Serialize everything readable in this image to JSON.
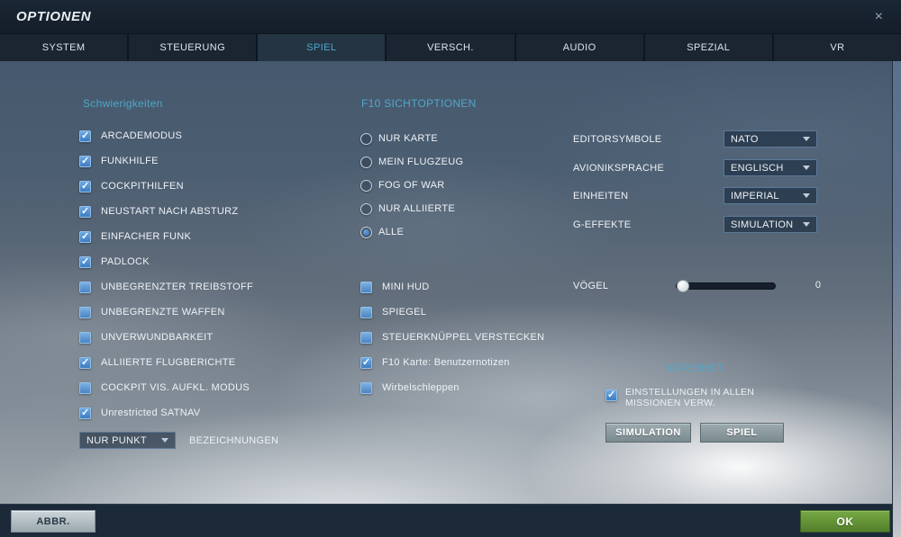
{
  "window": {
    "title": "OPTIONEN",
    "close_label": "×"
  },
  "tabs": {
    "items": [
      {
        "label": "SYSTEM",
        "active": false
      },
      {
        "label": "STEUERUNG",
        "active": false
      },
      {
        "label": "SPIEL",
        "active": true
      },
      {
        "label": "VERSCH.",
        "active": false
      },
      {
        "label": "AUDIO",
        "active": false
      },
      {
        "label": "SPEZIAL",
        "active": false
      },
      {
        "label": "VR",
        "active": false
      }
    ]
  },
  "difficulty": {
    "header": "Schwierigkeiten",
    "options": [
      {
        "label": "ARCADEMODUS",
        "checked": true
      },
      {
        "label": "FUNKHILFE",
        "checked": true
      },
      {
        "label": "COCKPITHILFEN",
        "checked": true
      },
      {
        "label": "NEUSTART NACH ABSTURZ",
        "checked": true
      },
      {
        "label": "EINFACHER FUNK",
        "checked": true
      },
      {
        "label": "PADLOCK",
        "checked": true
      },
      {
        "label": "UNBEGRENZTER TREIBSTOFF",
        "checked": false
      },
      {
        "label": "UNBEGRENZTE WAFFEN",
        "checked": false
      },
      {
        "label": "UNVERWUNDBARKEIT",
        "checked": false
      },
      {
        "label": "ALLIIERTE FLUGBERICHTE",
        "checked": true
      },
      {
        "label": "COCKPIT VIS. AUFKL. MODUS",
        "checked": false
      },
      {
        "label": "Unrestricted SATNAV",
        "checked": true
      }
    ],
    "labels_dropdown": {
      "value": "NUR PUNKT",
      "label": "BEZEICHNUNGEN"
    }
  },
  "f10_view": {
    "header": "F10 SICHTOPTIONEN",
    "options": [
      {
        "label": "NUR KARTE",
        "selected": false
      },
      {
        "label": "MEIN FLUGZEUG",
        "selected": false
      },
      {
        "label": "FOG OF WAR",
        "selected": false
      },
      {
        "label": "NUR ALLIIERTE",
        "selected": false
      },
      {
        "label": "ALLE",
        "selected": true
      }
    ]
  },
  "game_checkboxes": [
    {
      "label": "MINI HUD",
      "checked": false
    },
    {
      "label": "SPIEGEL",
      "checked": false
    },
    {
      "label": "STEUERKNÜPPEL VERSTECKEN",
      "checked": false
    },
    {
      "label": "F10 Karte: Benutzernotizen",
      "checked": true
    },
    {
      "label": "Wirbelschleppen",
      "checked": false
    }
  ],
  "settings": {
    "dropdowns": [
      {
        "label": "EDITORSYMBOLE",
        "value": "NATO"
      },
      {
        "label": "AVIONIKSPRACHE",
        "value": "ENGLISCH"
      },
      {
        "label": "EINHEITEN",
        "value": "IMPERIAL"
      },
      {
        "label": "G-EFFEKTE",
        "value": "SIMULATION"
      }
    ],
    "slider": {
      "label": "VÖGEL",
      "value": "0",
      "percent": 0
    }
  },
  "presets": {
    "header": "VOREINST.",
    "checkbox": {
      "label_line1": "EINSTELLUNGEN IN ALLEN",
      "label_line2": "MISSIONEN VERW.",
      "checked": true
    },
    "buttons": [
      {
        "label": "SIMULATION"
      },
      {
        "label": "SPIEL"
      }
    ]
  },
  "footer": {
    "cancel_label": "ABBR.",
    "ok_label": "OK"
  },
  "colors": {
    "accent": "#4fa7cc",
    "checkbox_blue": "#4a84c2",
    "ok_green": "#63973a"
  }
}
